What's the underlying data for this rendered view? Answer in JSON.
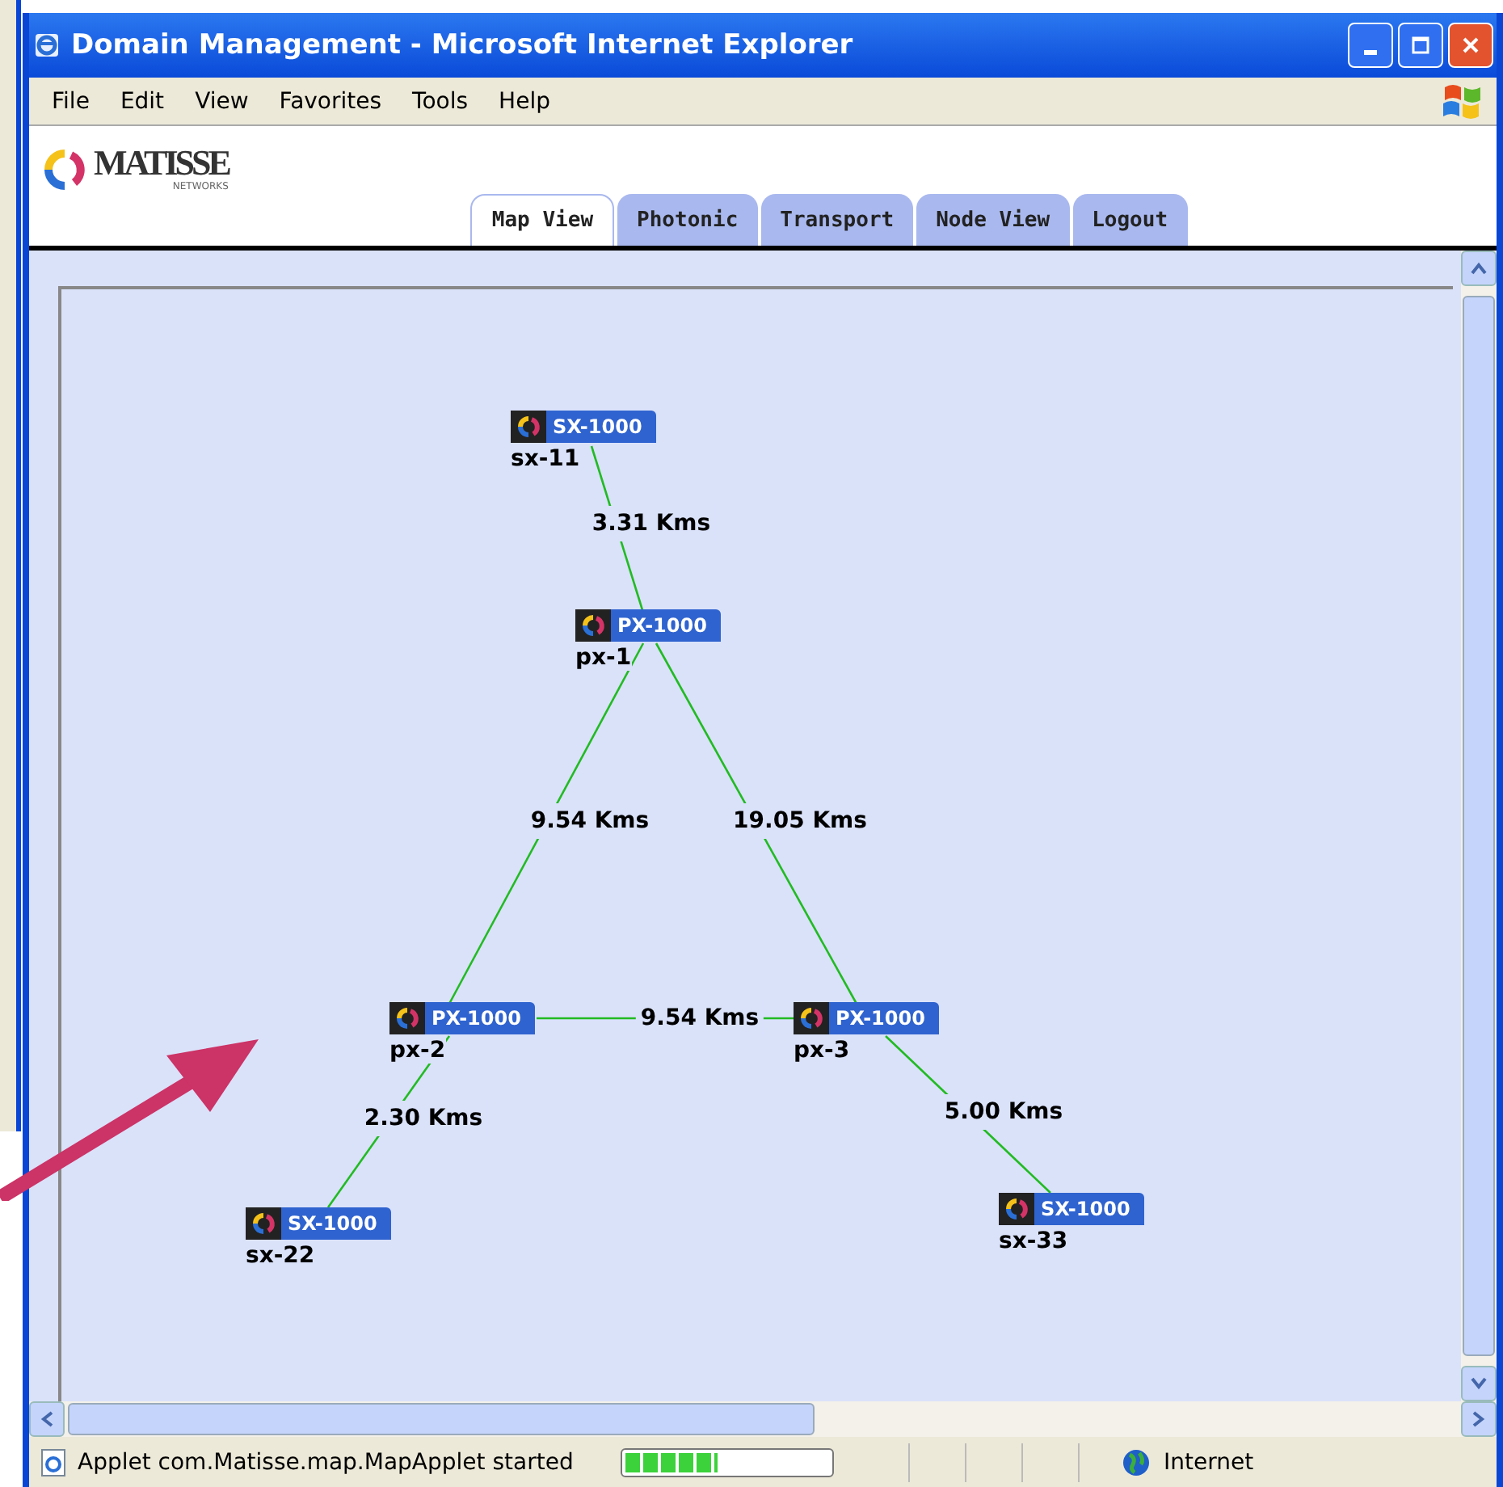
{
  "window": {
    "title": "Domain Management - Microsoft Internet Explorer"
  },
  "menu": [
    "File",
    "Edit",
    "View",
    "Favorites",
    "Tools",
    "Help"
  ],
  "logo": {
    "name": "MATISSE",
    "tagline": "NETWORKS"
  },
  "tabs": [
    {
      "label": "Map View",
      "selected": true
    },
    {
      "label": "Photonic",
      "selected": false
    },
    {
      "label": "Transport",
      "selected": false
    },
    {
      "label": "Node View",
      "selected": false
    },
    {
      "label": "Logout",
      "selected": false
    }
  ],
  "map": {
    "nodes": [
      {
        "model": "SX-1000",
        "name": "sx-11"
      },
      {
        "model": "PX-1000",
        "name": "px-1"
      },
      {
        "model": "PX-1000",
        "name": "px-2"
      },
      {
        "model": "PX-1000",
        "name": "px-3"
      },
      {
        "model": "SX-1000",
        "name": "sx-22"
      },
      {
        "model": "SX-1000",
        "name": "sx-33"
      }
    ],
    "links": [
      {
        "distance": "3.31 Kms"
      },
      {
        "distance": "9.54 Kms"
      },
      {
        "distance": "19.05 Kms"
      },
      {
        "distance": "9.54 Kms"
      },
      {
        "distance": "2.30 Kms"
      },
      {
        "distance": "5.00 Kms"
      }
    ]
  },
  "status_bar": {
    "message": "Applet com.Matisse.map.MapApplet started",
    "progress": {
      "level": 0.45
    },
    "zone": "Internet"
  }
}
